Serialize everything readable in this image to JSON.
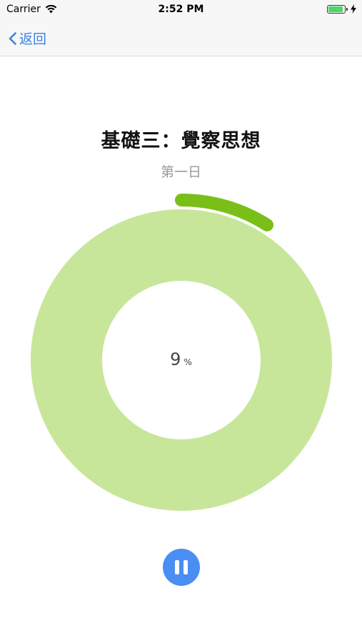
{
  "status_bar": {
    "carrier": "Carrier",
    "time": "2:52 PM"
  },
  "nav": {
    "back_label": "返回"
  },
  "content": {
    "title": "基礎三：覺察思想",
    "subtitle": "第一日"
  },
  "progress": {
    "percent_value": "9",
    "percent_unit": "%",
    "fraction": 0.09
  },
  "colors": {
    "accent": "#3b82e6",
    "progress_arc": "#7abf18",
    "ring": "#c7e69a",
    "pause_button": "#4a8df5"
  },
  "icons": {
    "back": "chevron-left-icon",
    "wifi": "wifi-icon",
    "battery": "battery-icon",
    "charging": "bolt-icon",
    "pause": "pause-icon"
  }
}
